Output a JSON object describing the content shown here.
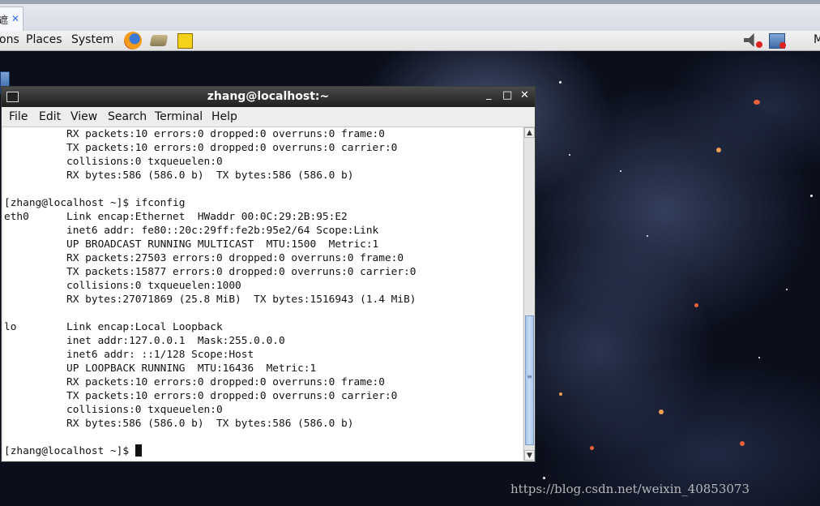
{
  "browser_tab": {
    "title_fragment": "遮",
    "close_glyph": "✕"
  },
  "panel": {
    "menus": [
      "ons",
      "Places",
      "System"
    ],
    "launchers": [
      "firefox-icon",
      "thunderbird-icon",
      "notes-icon"
    ],
    "tray": [
      "volume-muted-icon",
      "network-disconnected-icon"
    ],
    "clipped_text": "M"
  },
  "window": {
    "title": "zhang@localhost:~",
    "controls": {
      "minimize": "_",
      "maximize": "□",
      "close": "✕"
    },
    "menu": [
      "File",
      "Edit",
      "View",
      "Search",
      "Terminal",
      "Help"
    ]
  },
  "terminal": {
    "lines": [
      "          RX packets:10 errors:0 dropped:0 overruns:0 frame:0",
      "          TX packets:10 errors:0 dropped:0 overruns:0 carrier:0",
      "          collisions:0 txqueuelen:0",
      "          RX bytes:586 (586.0 b)  TX bytes:586 (586.0 b)",
      "",
      "[zhang@localhost ~]$ ifconfig",
      "eth0      Link encap:Ethernet  HWaddr 00:0C:29:2B:95:E2",
      "          inet6 addr: fe80::20c:29ff:fe2b:95e2/64 Scope:Link",
      "          UP BROADCAST RUNNING MULTICAST  MTU:1500  Metric:1",
      "          RX packets:27503 errors:0 dropped:0 overruns:0 frame:0",
      "          TX packets:15877 errors:0 dropped:0 overruns:0 carrier:0",
      "          collisions:0 txqueuelen:1000",
      "          RX bytes:27071869 (25.8 MiB)  TX bytes:1516943 (1.4 MiB)",
      "",
      "lo        Link encap:Local Loopback",
      "          inet addr:127.0.0.1  Mask:255.0.0.0",
      "          inet6 addr: ::1/128 Scope:Host",
      "          UP LOOPBACK RUNNING  MTU:16436  Metric:1",
      "          RX packets:10 errors:0 dropped:0 overruns:0 frame:0",
      "          TX packets:10 errors:0 dropped:0 overruns:0 carrier:0",
      "          collisions:0 txqueuelen:0",
      "          RX bytes:586 (586.0 b)  TX bytes:586 (586.0 b)",
      ""
    ],
    "prompt": "[zhang@localhost ~]$ "
  },
  "watermark": "https://blog.csdn.net/weixin_40853073"
}
